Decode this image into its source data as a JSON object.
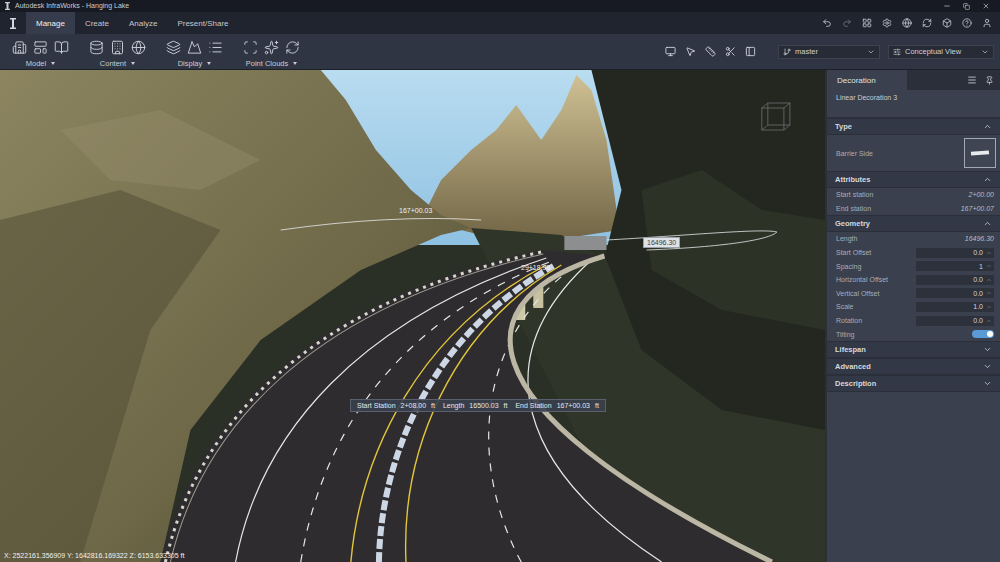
{
  "window": {
    "title": "Autodesk InfraWorks - Hanging Lake"
  },
  "tabs": [
    {
      "label": "Manage",
      "selected": true
    },
    {
      "label": "Create",
      "selected": false
    },
    {
      "label": "Analyze",
      "selected": false
    },
    {
      "label": "Present/Share",
      "selected": false
    }
  ],
  "ribbon": {
    "groups": [
      {
        "label": "Model"
      },
      {
        "label": "Content"
      },
      {
        "label": "Display"
      },
      {
        "label": "Point Clouds"
      }
    ],
    "branch": {
      "value": "master"
    },
    "view_style": {
      "value": "Conceptual View"
    }
  },
  "viewport": {
    "labels": [
      {
        "text": "167+00.03",
        "kind": "plain"
      },
      {
        "text": "29+18.98",
        "kind": "plain"
      },
      {
        "text": "16496.30",
        "kind": "tag"
      }
    ],
    "tooltip": [
      {
        "label": "Start Station",
        "value": "2+08.00",
        "unit": "ft"
      },
      {
        "label": "Length",
        "value": "16500.03",
        "unit": "ft"
      },
      {
        "label": "End Station",
        "value": "167+00.03",
        "unit": "ft"
      }
    ],
    "coordinates": "X: 2522161.356909 Y: 1642816.169322 Z: 6153.633305 ft"
  },
  "panel": {
    "tab": "Decoration",
    "subtitle": "Linear Decoration 3",
    "sections": [
      {
        "title": "Type",
        "expanded": true,
        "fields": [
          {
            "kind": "type",
            "label": "Barrier Side"
          }
        ]
      },
      {
        "title": "Attributes",
        "expanded": true,
        "fields": [
          {
            "kind": "readonly",
            "label": "Start station",
            "value": "2+00.00"
          },
          {
            "kind": "readonly",
            "label": "End station",
            "value": "167+00.07"
          }
        ]
      },
      {
        "title": "Geometry",
        "expanded": true,
        "fields": [
          {
            "kind": "readonly",
            "label": "Length",
            "value": "16496.30"
          },
          {
            "kind": "input",
            "label": "Start Offset",
            "value": "0.0"
          },
          {
            "kind": "input",
            "label": "Spacing",
            "value": "1"
          },
          {
            "kind": "input",
            "label": "Horizontal Offset",
            "value": "0.0"
          },
          {
            "kind": "input",
            "label": "Vertical Offset",
            "value": "0.0"
          },
          {
            "kind": "input",
            "label": "Scale",
            "value": "1.0"
          },
          {
            "kind": "input",
            "label": "Rotation",
            "value": "0.0"
          },
          {
            "kind": "toggle",
            "label": "Tilting",
            "on": true
          }
        ]
      },
      {
        "title": "Lifespan",
        "expanded": false,
        "fields": []
      },
      {
        "title": "Advanced",
        "expanded": false,
        "fields": []
      },
      {
        "title": "Description",
        "expanded": false,
        "fields": []
      }
    ]
  }
}
